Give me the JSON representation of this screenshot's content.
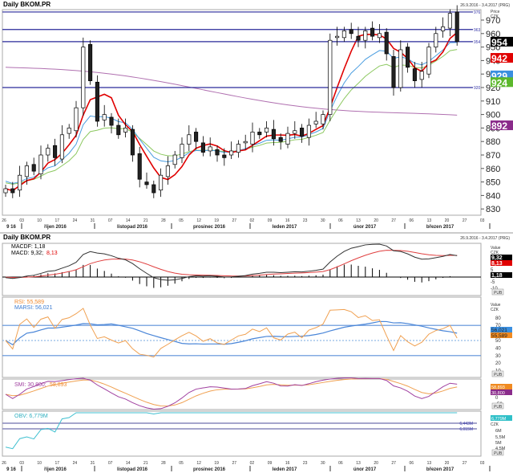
{
  "header": {
    "title": "Daily BKOM.PR",
    "range": "26.9.2016 - 3.4.2017 (PRG)",
    "price_label": "Price",
    "currency": "CZK"
  },
  "indicator_header": {
    "title": "Daily BKOM.PR",
    "range": "26.9.2016 - 3.4.2017 (PRG)"
  },
  "chart_data": {
    "type": "candlestick",
    "title": "Daily BKOM.PR",
    "ylim": [
      826,
      982
    ],
    "yticks": [
      970,
      960,
      950,
      940,
      930,
      920,
      910,
      900,
      890,
      880,
      870,
      860,
      850,
      840,
      830
    ],
    "closes": [
      845,
      842,
      855,
      862,
      858,
      870,
      875,
      868,
      885,
      890,
      905,
      950,
      925,
      895,
      900,
      892,
      885,
      890,
      870,
      852,
      848,
      842,
      855,
      862,
      870,
      878,
      885,
      880,
      872,
      876,
      870,
      868,
      873,
      878,
      880,
      887,
      885,
      890,
      882,
      880,
      886,
      888,
      884,
      892,
      895,
      900,
      955,
      958,
      962,
      960,
      955,
      962,
      958,
      960,
      945,
      920,
      948,
      935,
      925,
      932,
      950,
      960,
      965,
      975,
      954
    ],
    "hlines": [
      {
        "value": 976,
        "label": "976"
      },
      {
        "value": 963,
        "label": "963"
      },
      {
        "value": 954,
        "label": "954"
      },
      {
        "value": 920,
        "label": "920"
      }
    ],
    "value_tags": [
      {
        "label": "954",
        "value": 954,
        "color": "#000000"
      },
      {
        "label": "942",
        "value": 942,
        "color": "#e00000"
      },
      {
        "label": "929",
        "value": 929,
        "color": "#3a8fe0"
      },
      {
        "label": "924",
        "value": 924,
        "color": "#5cb82c"
      },
      {
        "label": "892",
        "value": 892,
        "color": "#8a2b8a"
      }
    ],
    "day_ticks": [
      "26",
      "03",
      "10",
      "17",
      "24",
      "31",
      "07",
      "14",
      "21",
      "28",
      "05",
      "12",
      "19",
      "27",
      "02",
      "09",
      "16",
      "23",
      "30",
      "06",
      "13",
      "20",
      "27",
      "06",
      "13",
      "20",
      "27",
      "03"
    ],
    "months": [
      "9 16",
      "říjen 2016",
      "listopad 2016",
      "prosinec 2016",
      "leden 2017",
      "únor 2017",
      "březen 2017"
    ],
    "macd": {
      "legend1": "MACDF: 1,18",
      "legend2a": "MACD: 9,32; ",
      "legend2b": "8,13",
      "tags": [
        "9,32",
        "8,13",
        "1,18"
      ],
      "ticks": [
        "5",
        "-5",
        "-10"
      ],
      "value_label": "Value",
      "currency": "CZK"
    },
    "rsi": {
      "legend1": "RSI: 55,589",
      "legend2": "MARSI: 56,021",
      "tags": [
        "56,021",
        "55,589"
      ],
      "ticks": [
        "80",
        "70",
        "60",
        "50",
        "40",
        "30",
        "20",
        "10"
      ],
      "levels": [
        70,
        30
      ],
      "value_label": "Value",
      "currency": "CZK"
    },
    "smi": {
      "legend_a": "SMI: 30,800; ",
      "legend_b": "58,893",
      "tags": [
        "58,893",
        "30,800"
      ],
      "ticks": [
        "0",
        "-50"
      ]
    },
    "obv": {
      "legend": "OBV: 6,779M",
      "tag": "6,779M",
      "currency": "CZK",
      "lines": [
        "6,443M",
        "6,015M"
      ],
      "ticks": [
        "6M",
        "5,5M",
        "5M",
        "4,5M"
      ]
    },
    "corner_label": "PUB"
  }
}
